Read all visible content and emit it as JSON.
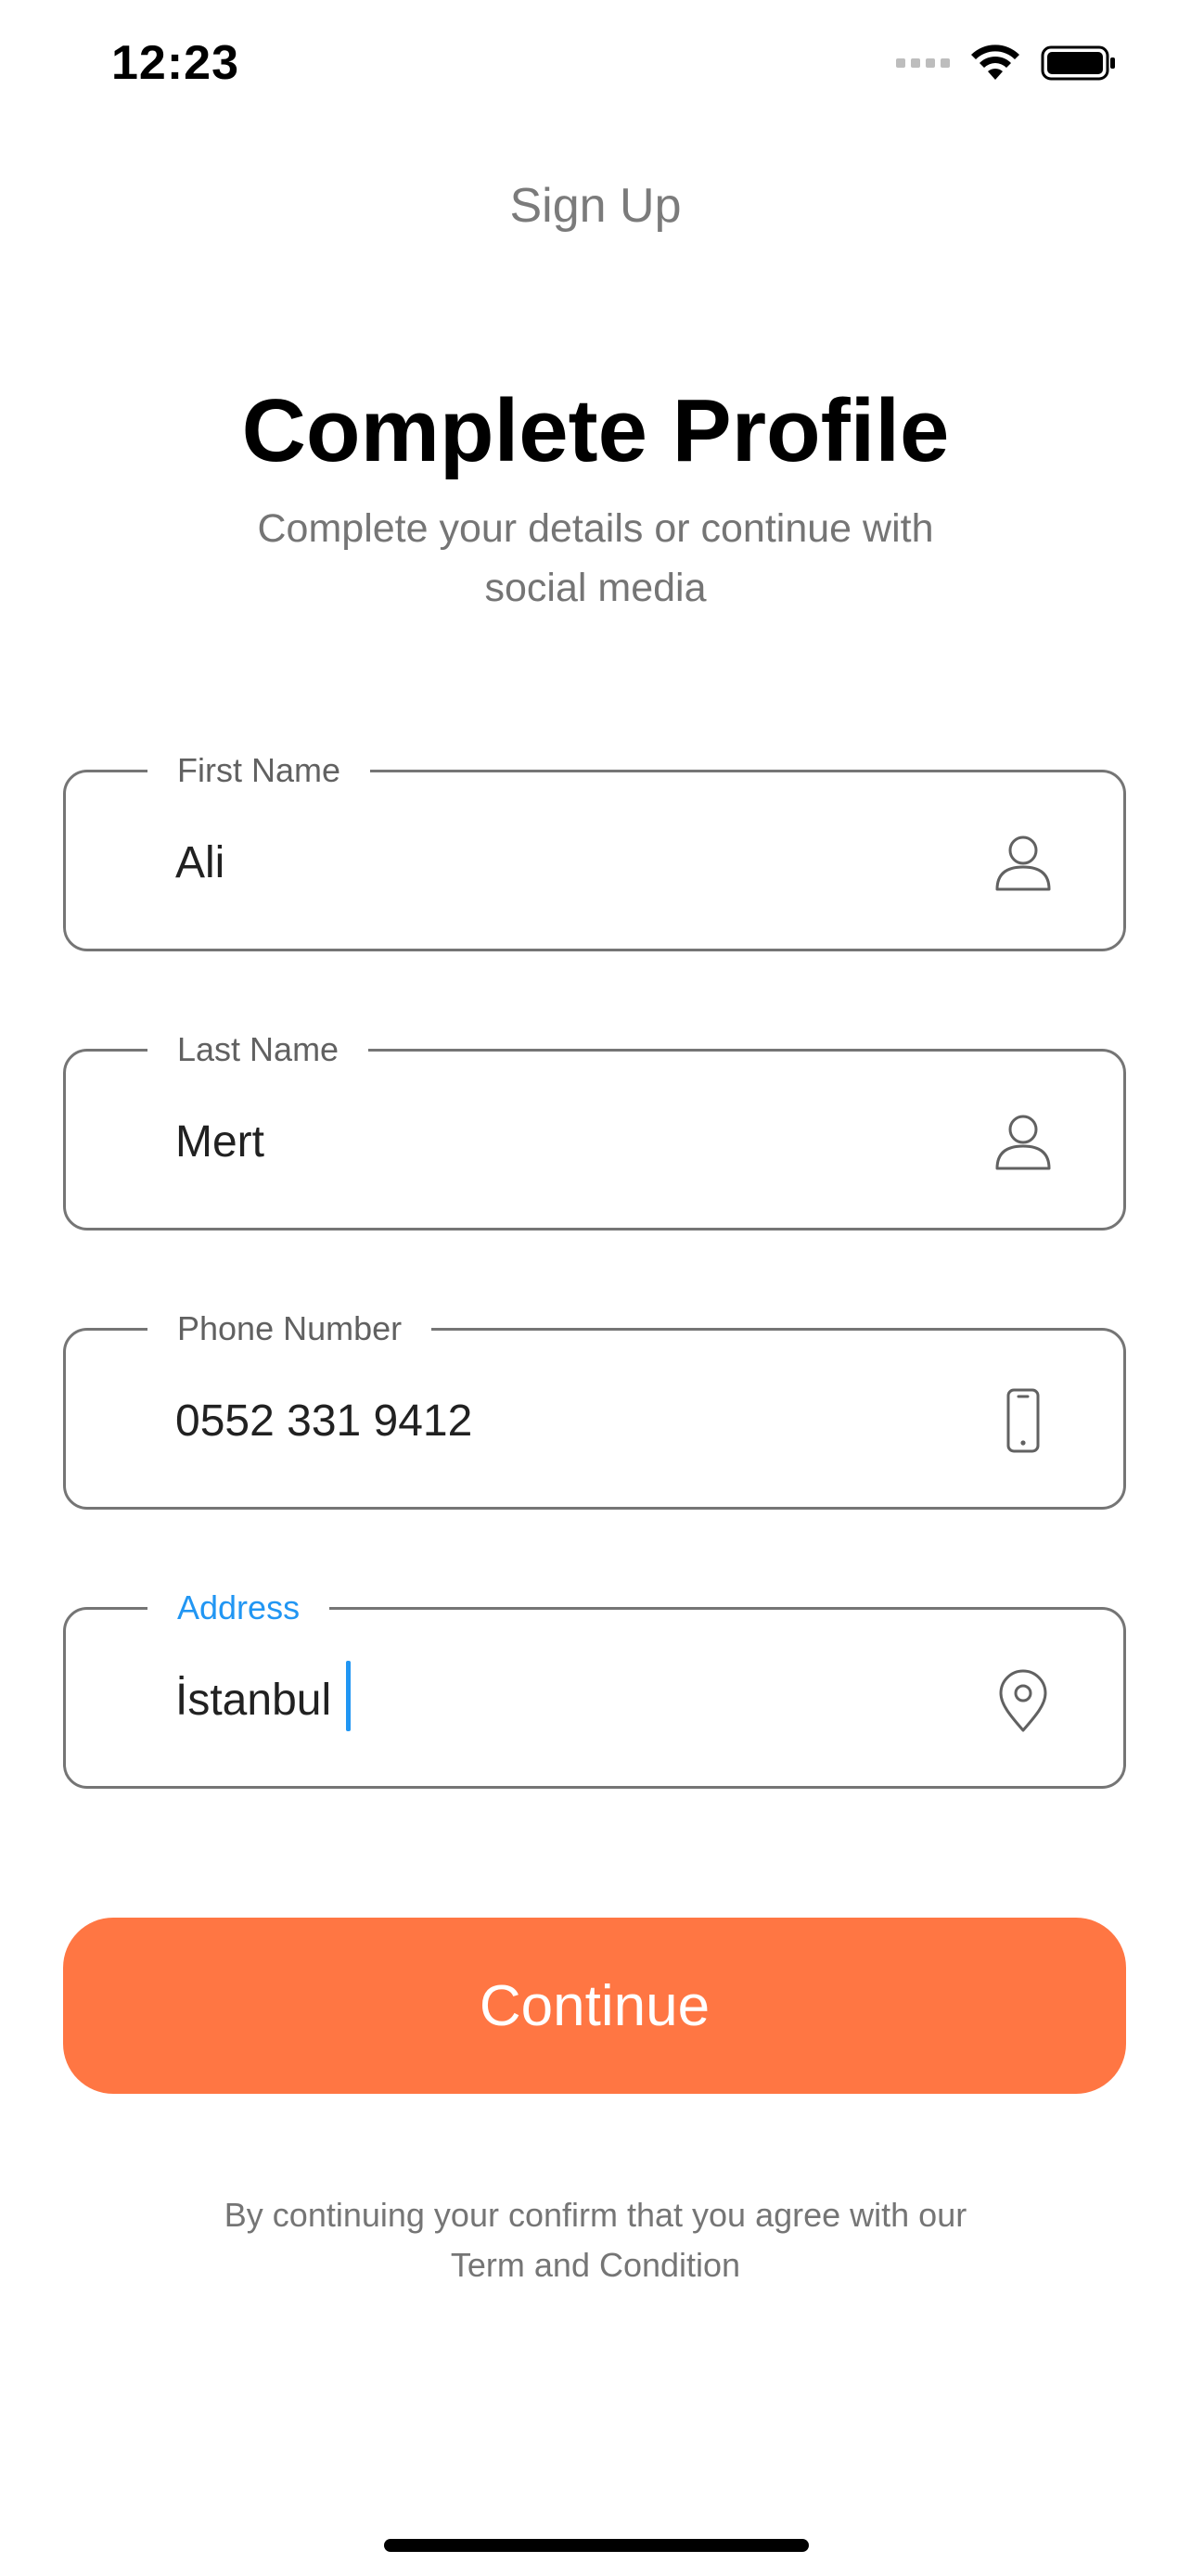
{
  "status_bar": {
    "time": "12:23"
  },
  "nav": {
    "title": "Sign Up"
  },
  "header": {
    "title": "Complete Profile",
    "subtitle": "Complete your details or continue with social media"
  },
  "form": {
    "fields": [
      {
        "label": "First Name",
        "value": "Ali",
        "icon": "user-icon"
      },
      {
        "label": "Last Name",
        "value": "Mert",
        "icon": "user-icon"
      },
      {
        "label": "Phone Number",
        "value": "0552 331 9412",
        "icon": "phone-icon"
      },
      {
        "label": "Address",
        "value": "İstanbul",
        "icon": "location-pin-icon",
        "focused": true
      }
    ]
  },
  "actions": {
    "continue_label": "Continue"
  },
  "footer": {
    "terms": "By continuing your confirm that you agree with our Term and Condition"
  },
  "colors": {
    "accent": "#FF7643",
    "focus": "#2196F3",
    "border": "#757575",
    "muted_text": "#757575"
  }
}
